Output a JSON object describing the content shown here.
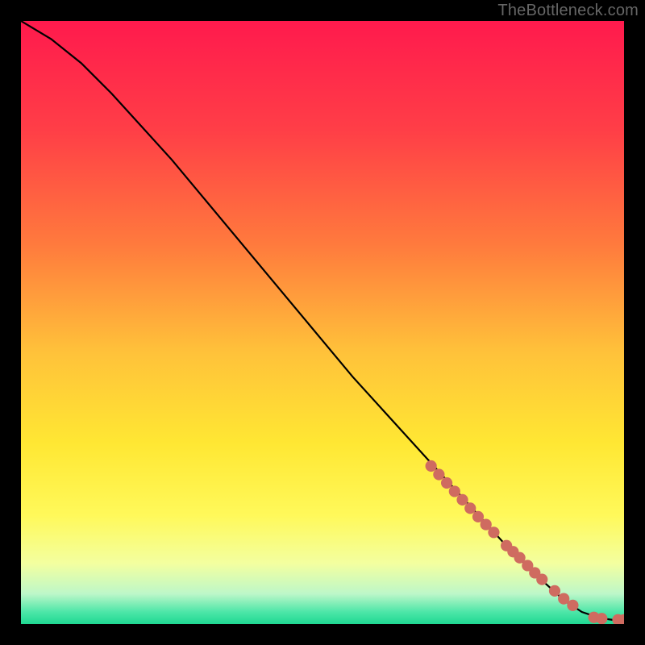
{
  "watermark": "TheBottleneck.com",
  "chart_data": {
    "type": "line",
    "title": "",
    "xlabel": "",
    "ylabel": "",
    "xlim": [
      0,
      100
    ],
    "ylim": [
      0,
      100
    ],
    "background_gradient": {
      "stops": [
        {
          "offset": 0,
          "color": "#ff1a4d"
        },
        {
          "offset": 18,
          "color": "#ff3e47"
        },
        {
          "offset": 37,
          "color": "#ff7a3d"
        },
        {
          "offset": 55,
          "color": "#ffc23a"
        },
        {
          "offset": 70,
          "color": "#ffe733"
        },
        {
          "offset": 82,
          "color": "#fff95a"
        },
        {
          "offset": 90,
          "color": "#f3ffa0"
        },
        {
          "offset": 95,
          "color": "#bdf7c9"
        },
        {
          "offset": 98,
          "color": "#4de6a8"
        },
        {
          "offset": 100,
          "color": "#1fd892"
        }
      ]
    },
    "series": [
      {
        "name": "curve",
        "type": "line",
        "x": [
          0,
          5,
          10,
          15,
          20,
          25,
          30,
          35,
          40,
          45,
          50,
          55,
          60,
          65,
          70,
          75,
          80,
          85,
          90,
          93,
          96,
          98,
          100
        ],
        "y": [
          100,
          97,
          93,
          88,
          82.5,
          77,
          71,
          65,
          59,
          53,
          47,
          41,
          35.5,
          30,
          24.5,
          19,
          13.5,
          8.5,
          4,
          2,
          1,
          0.7,
          0.7
        ]
      },
      {
        "name": "highlight-dots",
        "type": "scatter",
        "x": [
          68,
          69.3,
          70.6,
          71.9,
          73.2,
          74.5,
          75.8,
          77.1,
          78.4,
          80.5,
          81.6,
          82.7,
          84,
          85.2,
          86.4,
          88.5,
          90,
          91.5,
          95,
          96.3,
          99,
          100
        ],
        "y": [
          26.2,
          24.8,
          23.4,
          22,
          20.6,
          19.2,
          17.8,
          16.5,
          15.2,
          13,
          12,
          11,
          9.7,
          8.5,
          7.4,
          5.5,
          4.2,
          3.1,
          1.1,
          0.9,
          0.7,
          0.7
        ]
      }
    ]
  }
}
